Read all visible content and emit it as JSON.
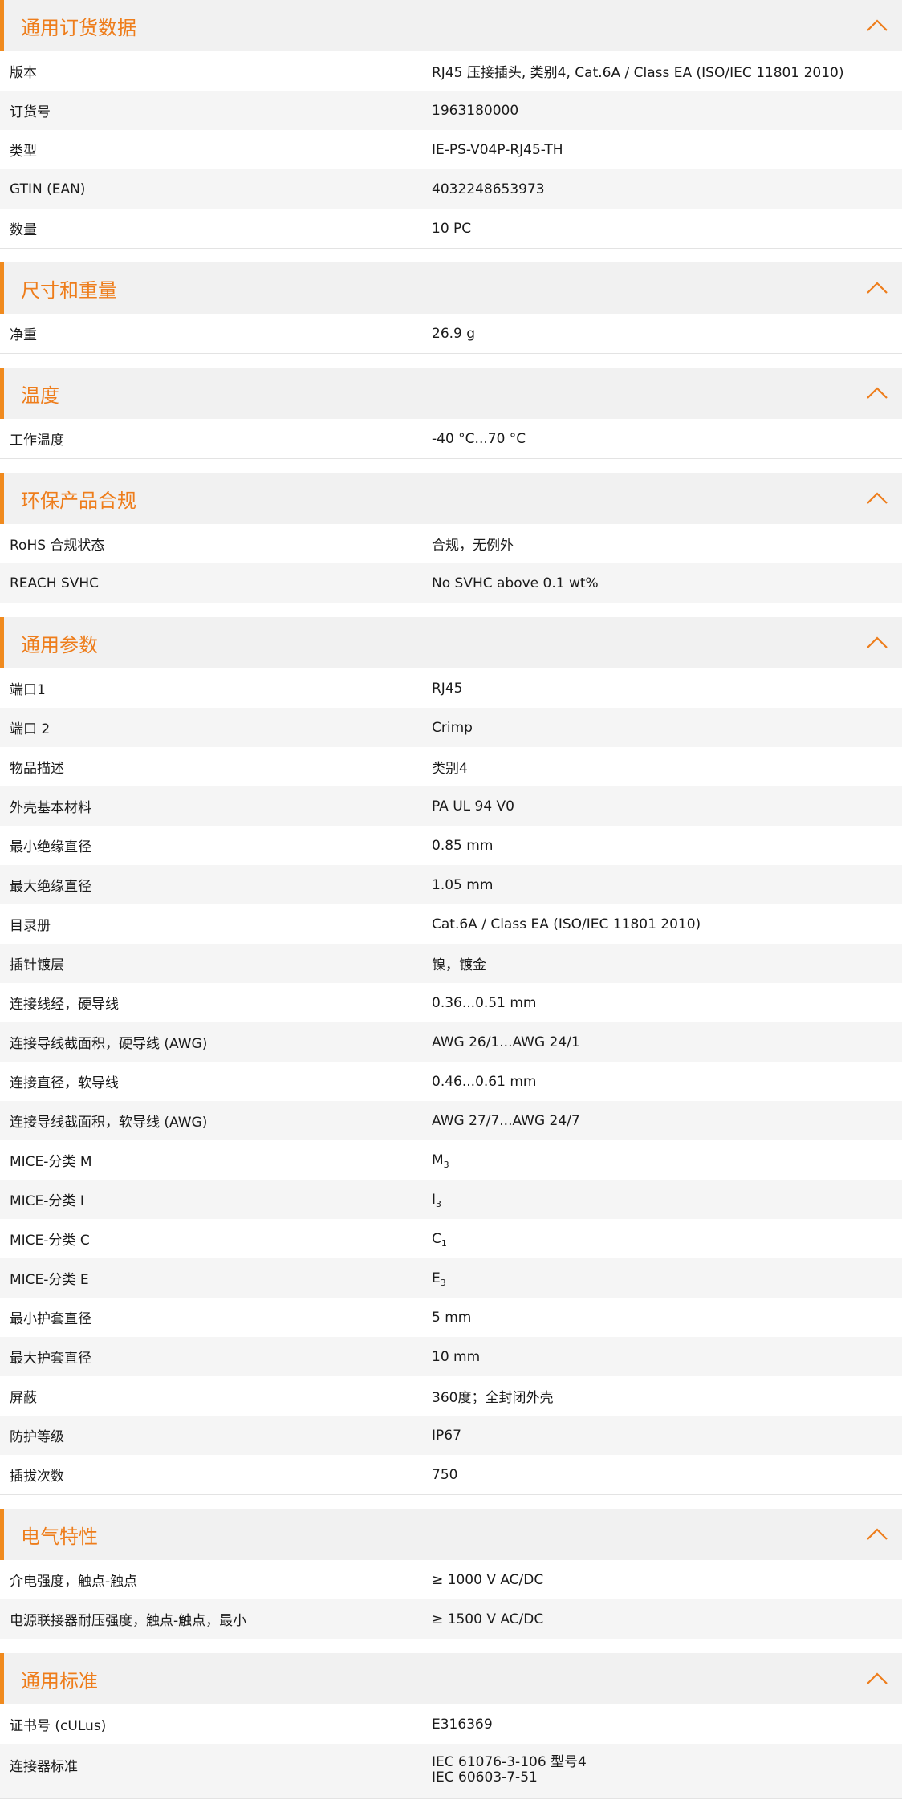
{
  "accent_color": "#ee7d1b",
  "sections": [
    {
      "title": "通用订货数据",
      "rows": [
        {
          "label": "版本",
          "value": "RJ45 压接插头, 类别4, Cat.6A / Class EA (ISO/IEC 11801 2010)"
        },
        {
          "label": "订货号",
          "value": "1963180000"
        },
        {
          "label": "类型",
          "value": "IE-PS-V04P-RJ45-TH"
        },
        {
          "label": "GTIN (EAN)",
          "value": "4032248653973"
        },
        {
          "label": "数量",
          "value": "10  PC"
        }
      ]
    },
    {
      "title": "尺寸和重量",
      "rows": [
        {
          "label": "净重",
          "value": "26.9  g"
        }
      ]
    },
    {
      "title": "温度",
      "rows": [
        {
          "label": "工作温度",
          "value": "-40 °C...70 °C"
        }
      ]
    },
    {
      "title": "环保产品合规",
      "rows": [
        {
          "label": "RoHS 合规状态",
          "value": "合规，无例外"
        },
        {
          "label": "REACH SVHC",
          "value": "No SVHC above 0.1 wt%"
        }
      ]
    },
    {
      "title": "通用参数",
      "rows": [
        {
          "label": "端口1",
          "value": "RJ45"
        },
        {
          "label": "端口 2",
          "value": "Crimp"
        },
        {
          "label": "物品描述",
          "value": "类别4"
        },
        {
          "label": "外壳基本材料",
          "value": "PA UL 94 V0"
        },
        {
          "label": "最小绝缘直径",
          "value": "0.85  mm"
        },
        {
          "label": "最大绝缘直径",
          "value": "1.05  mm"
        },
        {
          "label": "目录册",
          "value": "Cat.6A / Class EA (ISO/IEC 11801 2010)"
        },
        {
          "label": "插针镀层",
          "value": "镍，镀金"
        },
        {
          "label": "连接线经，硬导线",
          "value": "0.36...0.51 mm"
        },
        {
          "label": "连接导线截面积，硬导线 (AWG)",
          "value": "AWG 26/1...AWG 24/1"
        },
        {
          "label": "连接直径，软导线",
          "value": "0.46...0.61 mm"
        },
        {
          "label": "连接导线截面积，软导线 (AWG)",
          "value": "AWG 27/7...AWG 24/7"
        },
        {
          "label": "MICE-分类 M",
          "value": "M",
          "sub": "3"
        },
        {
          "label": "MICE-分类 I",
          "value": "I",
          "sub": "3"
        },
        {
          "label": "MICE-分类 C",
          "value": "C",
          "sub": "1"
        },
        {
          "label": "MICE-分类 E",
          "value": "E",
          "sub": "3"
        },
        {
          "label": "最小护套直径",
          "value": "5  mm"
        },
        {
          "label": "最大护套直径",
          "value": "10  mm"
        },
        {
          "label": "屏蔽",
          "value": "360度；全封闭外壳"
        },
        {
          "label": "防护等级",
          "value": "IP67"
        },
        {
          "label": "插拔次数",
          "value": "750"
        }
      ]
    },
    {
      "title": "电气特性",
      "rows": [
        {
          "label": "介电强度，触点-触点",
          "value": "≥ 1000 V AC/DC"
        },
        {
          "label": "电源联接器耐压强度，触点-触点，最小",
          "value": "≥ 1500 V AC/DC"
        }
      ]
    },
    {
      "title": "通用标准",
      "rows": [
        {
          "label": "证书号 (cULus)",
          "value": "E316369"
        },
        {
          "label": "连接器标准",
          "lines": [
            "IEC 61076-3-106 型号4",
            "IEC 60603-7-51"
          ]
        }
      ]
    }
  ]
}
